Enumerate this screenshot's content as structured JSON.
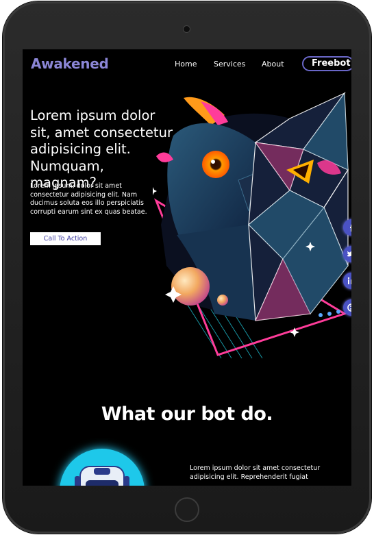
{
  "brand": "Awakened",
  "nav": {
    "links": [
      "Home",
      "Services",
      "About"
    ],
    "cta": "Freebot"
  },
  "hero": {
    "title": "Lorem ipsum dolor sit, amet consectetur adipisicing elit. Numquam, magnam?",
    "text": "Lorem ipsum, dolor sit amet consectetur adipisicing elit. Nam ducimus soluta eos illo perspiciatis corrupti earum sint ex quas beatae.",
    "button": "Call To Action"
  },
  "social_icons": [
    "facebook-icon",
    "twitter-icon",
    "linkedin-icon",
    "skype-icon"
  ],
  "colors": {
    "accent": "#6a67c8",
    "brand": "#8b86d6",
    "social": "#4a52c4",
    "bot_circle": "#1ec8ea"
  },
  "section": {
    "title": "What our bot do.",
    "text": "Lorem ipsum dolor sit amet consectetur adipisicing elit. Reprehenderit fugiat"
  }
}
